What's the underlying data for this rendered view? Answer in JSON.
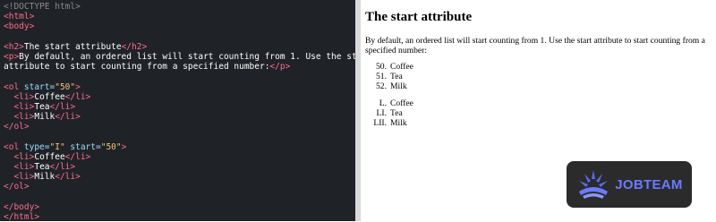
{
  "editor": {
    "lines": {
      "l1": "<!DOCTYPE html>",
      "l2": "<html>",
      "l3": "<body>",
      "l5a": "<h2>",
      "l5b": "The start attribute",
      "l5c": "</h2>",
      "l6a": "<p>",
      "l6b": "By default, an ordered list will start counting from 1. Use the start",
      "l7a": "attribute to start counting from a specified number:",
      "l7b": "</p>",
      "l9a": "<ol ",
      "l9b": "start=",
      "l9c": "\"50\"",
      "l9d": ">",
      "l10a": "<li>",
      "l10b": "Coffee",
      "l10c": "</li>",
      "l11a": "<li>",
      "l11b": "Tea",
      "l11c": "</li>",
      "l12a": "<li>",
      "l12b": "Milk",
      "l12c": "</li>",
      "l13": "</ol>",
      "l15a": "<ol ",
      "l15b": "type=",
      "l15c": "\"I\"",
      "l15d": " start=",
      "l15e": "\"50\"",
      "l15f": ">",
      "l16a": "<li>",
      "l16b": "Coffee",
      "l16c": "</li>",
      "l17a": "<li>",
      "l17b": "Tea",
      "l17c": "</li>",
      "l18a": "<li>",
      "l18b": "Milk",
      "l18c": "</li>",
      "l19": "</ol>",
      "l21": "</body>",
      "l22": "</html>"
    }
  },
  "preview": {
    "heading": "The start attribute",
    "paragraph": "By default, an ordered list will start counting from 1. Use the start attribute to start counting from a specified number:",
    "list1": [
      {
        "num": "50.",
        "text": "Coffee"
      },
      {
        "num": "51.",
        "text": "Tea"
      },
      {
        "num": "52.",
        "text": "Milk"
      }
    ],
    "list2": [
      {
        "num": "L.",
        "text": "Coffee"
      },
      {
        "num": "LI.",
        "text": "Tea"
      },
      {
        "num": "LII.",
        "text": "Milk"
      }
    ]
  },
  "logo": {
    "brand": "JOBTEAM",
    "icon": "jobteam-logo-icon",
    "brand_color": "#6a7bff"
  }
}
